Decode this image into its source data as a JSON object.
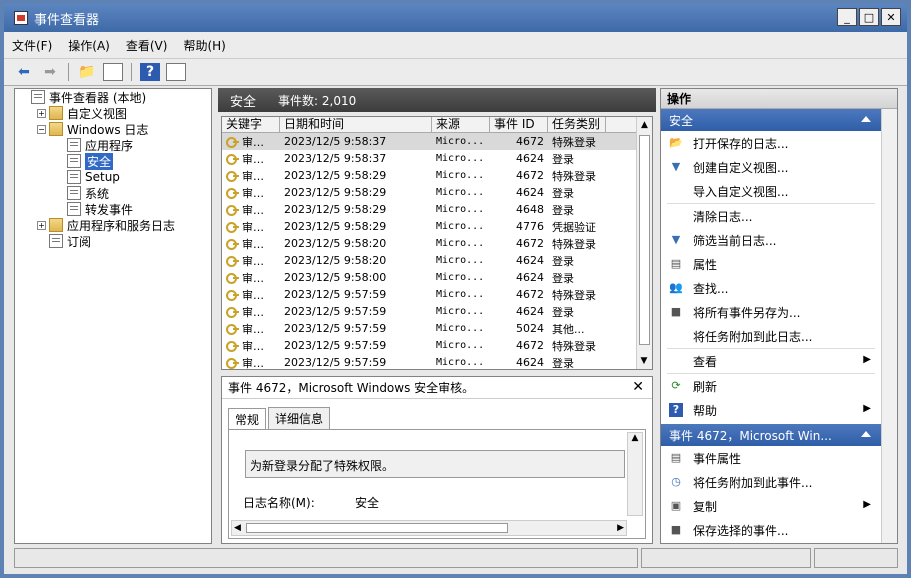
{
  "window": {
    "title": "事件查看器"
  },
  "menu": [
    "文件(F)",
    "操作(A)",
    "查看(V)",
    "帮助(H)"
  ],
  "tree": [
    {
      "label": "事件查看器 (本地)",
      "level": 0,
      "expander": "",
      "icon": "event-viewer-icon"
    },
    {
      "label": "自定义视图",
      "level": 1,
      "expander": "+",
      "icon": "folder-icon"
    },
    {
      "label": "Windows 日志",
      "level": 1,
      "expander": "−",
      "icon": "folder-icon"
    },
    {
      "label": "应用程序",
      "level": 2,
      "expander": "",
      "icon": "log-icon"
    },
    {
      "label": "安全",
      "level": 2,
      "expander": "",
      "icon": "log-icon",
      "selected": true
    },
    {
      "label": "Setup",
      "level": 2,
      "expander": "",
      "icon": "log-icon"
    },
    {
      "label": "系统",
      "level": 2,
      "expander": "",
      "icon": "log-icon"
    },
    {
      "label": "转发事件",
      "level": 2,
      "expander": "",
      "icon": "log-icon"
    },
    {
      "label": "应用程序和服务日志",
      "level": 1,
      "expander": "+",
      "icon": "folder-icon"
    },
    {
      "label": "订阅",
      "level": 1,
      "expander": "",
      "icon": "subscription-icon"
    }
  ],
  "center": {
    "title": "安全",
    "count_label": "事件数: 2,010"
  },
  "columns": [
    "关键字",
    "日期和时间",
    "来源",
    "事件 ID",
    "任务类别"
  ],
  "events": [
    [
      "审…",
      "2023/12/5 9:58:37",
      "Micro...",
      "4672",
      "特殊登录"
    ],
    [
      "审…",
      "2023/12/5 9:58:37",
      "Micro...",
      "4624",
      "登录"
    ],
    [
      "审…",
      "2023/12/5 9:58:29",
      "Micro...",
      "4672",
      "特殊登录"
    ],
    [
      "审…",
      "2023/12/5 9:58:29",
      "Micro...",
      "4624",
      "登录"
    ],
    [
      "审…",
      "2023/12/5 9:58:29",
      "Micro...",
      "4648",
      "登录"
    ],
    [
      "审…",
      "2023/12/5 9:58:29",
      "Micro...",
      "4776",
      "凭据验证"
    ],
    [
      "审…",
      "2023/12/5 9:58:20",
      "Micro...",
      "4672",
      "特殊登录"
    ],
    [
      "审…",
      "2023/12/5 9:58:20",
      "Micro...",
      "4624",
      "登录"
    ],
    [
      "审…",
      "2023/12/5 9:58:00",
      "Micro...",
      "4624",
      "登录"
    ],
    [
      "审…",
      "2023/12/5 9:57:59",
      "Micro...",
      "4672",
      "特殊登录"
    ],
    [
      "审…",
      "2023/12/5 9:57:59",
      "Micro...",
      "4624",
      "登录"
    ],
    [
      "审…",
      "2023/12/5 9:57:59",
      "Micro...",
      "5024",
      "其他..."
    ],
    [
      "审…",
      "2023/12/5 9:57:59",
      "Micro...",
      "4672",
      "特殊登录"
    ],
    [
      "审…",
      "2023/12/5 9:57:59",
      "Micro...",
      "4624",
      "登录"
    ]
  ],
  "detail": {
    "title": "事件 4672，Microsoft Windows 安全审核。",
    "tabs": [
      "常规",
      "详细信息"
    ],
    "message": "为新登录分配了特殊权限。",
    "log_name_label": "日志名称(M):",
    "log_name_value": "安全"
  },
  "actions": {
    "header": "操作",
    "section1": "安全",
    "items1": [
      {
        "label": "打开保存的日志...",
        "icon": "open-folder-icon",
        "sub": false
      },
      {
        "label": "创建自定义视图...",
        "icon": "filter-icon",
        "sub": false
      },
      {
        "label": "导入自定义视图...",
        "icon": "",
        "sub": false
      },
      {
        "sep": true
      },
      {
        "label": "清除日志...",
        "icon": "",
        "sub": false
      },
      {
        "label": "筛选当前日志...",
        "icon": "filter-icon",
        "sub": false
      },
      {
        "label": "属性",
        "icon": "properties-icon",
        "sub": false
      },
      {
        "label": "查找...",
        "icon": "find-icon",
        "sub": false
      },
      {
        "label": "将所有事件另存为...",
        "icon": "save-icon",
        "sub": false
      },
      {
        "label": "将任务附加到此日志...",
        "icon": "",
        "sub": false
      },
      {
        "sep": true
      },
      {
        "label": "查看",
        "icon": "",
        "sub": true
      },
      {
        "sep": true
      },
      {
        "label": "刷新",
        "icon": "refresh-icon",
        "sub": false
      },
      {
        "label": "帮助",
        "icon": "help-icon",
        "sub": true
      }
    ],
    "section2": "事件 4672，Microsoft Win...",
    "items2": [
      {
        "label": "事件属性",
        "icon": "properties-icon",
        "sub": false
      },
      {
        "label": "将任务附加到此事件...",
        "icon": "task-icon",
        "sub": false
      },
      {
        "label": "复制",
        "icon": "copy-icon",
        "sub": true
      },
      {
        "label": "保存选择的事件...",
        "icon": "save-icon",
        "sub": false
      }
    ]
  }
}
